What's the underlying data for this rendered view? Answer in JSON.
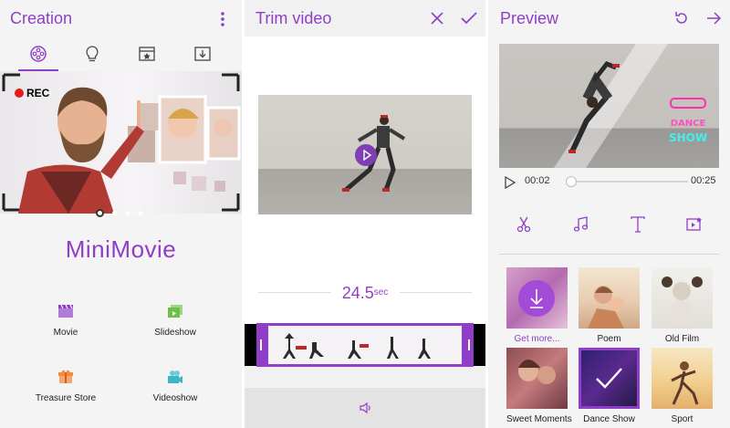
{
  "creation": {
    "title": "Creation",
    "rec_label": "REC",
    "logo_text": "MiniMovie",
    "features": [
      {
        "label": "Movie",
        "icon": "clapperboard-icon",
        "color": "#8f3fc7"
      },
      {
        "label": "Slideshow",
        "icon": "slideshow-icon",
        "color": "#6cbf4a"
      },
      {
        "label": "Treasure Store",
        "icon": "gift-icon",
        "color": "#f08a3c"
      },
      {
        "label": "Videoshow",
        "icon": "camera-icon",
        "color": "#3fb4c4"
      }
    ],
    "tabs": [
      "film-reel-icon",
      "lightbulb-icon",
      "star-video-icon",
      "download-icon"
    ]
  },
  "trim": {
    "title": "Trim video",
    "duration_value": "24.5",
    "duration_unit": "sec"
  },
  "preview": {
    "title": "Preview",
    "current_time": "00:02",
    "total_time": "00:25",
    "progress": 0.02,
    "themes": [
      {
        "label": "Get more...",
        "accent": true
      },
      {
        "label": "Poem",
        "accent": false
      },
      {
        "label": "Old Film",
        "accent": false
      },
      {
        "label": "Sweet Moments",
        "accent": false
      },
      {
        "label": "Dance Show",
        "accent": false,
        "selected": true
      },
      {
        "label": "Sport",
        "accent": false
      }
    ]
  },
  "colors": {
    "accent": "#8f3fc7"
  }
}
